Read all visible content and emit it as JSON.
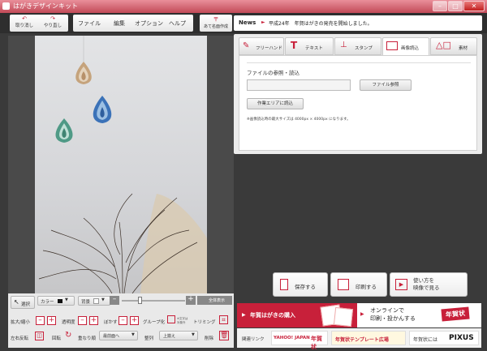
{
  "app": {
    "title": "はがきデザインキット"
  },
  "window_controls": {
    "minimize": "–",
    "maximize": "□",
    "close": "✕"
  },
  "toolbar": {
    "undo": "取り消し",
    "redo": "やり直し",
    "menu": [
      "ファイル",
      "編集",
      "オプション",
      "ヘルプ"
    ],
    "address": "あて名面作成"
  },
  "news": {
    "label": "News",
    "text": "平成24年　年賀はがきの発売を開始しました。"
  },
  "tabs": [
    "フリーハンド",
    "テキスト",
    "スタンプ",
    "画像読込",
    "素材"
  ],
  "image_panel": {
    "title": "ファイルの参照・読込",
    "file_value": "",
    "browse": "ファイル参照",
    "load": "作業エリアに読込",
    "note": "※画像読込時の最大サイズは 4000px × 4000px になります。"
  },
  "view_tools": {
    "select": "選択",
    "color_label": "カラー",
    "bg_label": "背景",
    "fit": "全体表示"
  },
  "edit_tools": {
    "zoom": "拡大/縮小",
    "opacity": "透明度",
    "blur": "ぼかす",
    "group": "グループ化",
    "group_sub": "※文字は対象外",
    "trim": "トリミング",
    "flip": "左右反転",
    "rotate": "回転",
    "order": "重なり順",
    "order_value": "最前面へ",
    "align": "整列",
    "align_value": "上揃え",
    "delete": "削除"
  },
  "actions": {
    "save": "保存する",
    "print": "印刷する",
    "video": "使い方を\n映像で見る"
  },
  "banners": {
    "buy": "年賀はがきの購入",
    "online": "オンラインで\n印刷・投かんする",
    "online_logo": "年賀状"
  },
  "links": {
    "label": "関連リンク",
    "yahoo": "YAHOO! JAPAN",
    "yahoo_sub": "年賀状",
    "template": "年賀状テンプレート広場",
    "pixus_pre": "年賀状には",
    "pixus": "PIXUS"
  },
  "colors": {
    "accent": "#c8203a",
    "title_bar": "#d46a77",
    "dark_bg": "#3a3a3a"
  }
}
